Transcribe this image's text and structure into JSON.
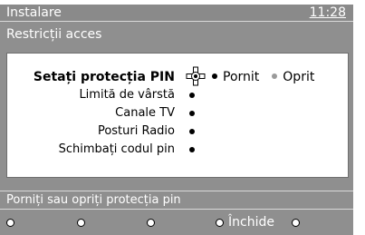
{
  "header": {
    "title": "Instalare",
    "clock": "11:28"
  },
  "subtitle": "Restricții acces",
  "menu": {
    "items": [
      {
        "label": "Setați protecția PIN"
      },
      {
        "label": "Limită de vârstă"
      },
      {
        "label": "Canale TV"
      },
      {
        "label": "Posturi Radio"
      },
      {
        "label": "Schimbați codul pin"
      }
    ]
  },
  "options": [
    {
      "label": "Pornit",
      "bullet_color": "#000000"
    },
    {
      "label": "Oprit",
      "bullet_color": "#9a9a9a"
    }
  ],
  "status_text": "Porniți sau opriți protecția pin",
  "bottom_keys": {
    "close_label": "Închide"
  },
  "colors": {
    "screen_bg": "#8f8f8f",
    "panel_bg": "#ffffff",
    "text_light": "#ffffff"
  }
}
